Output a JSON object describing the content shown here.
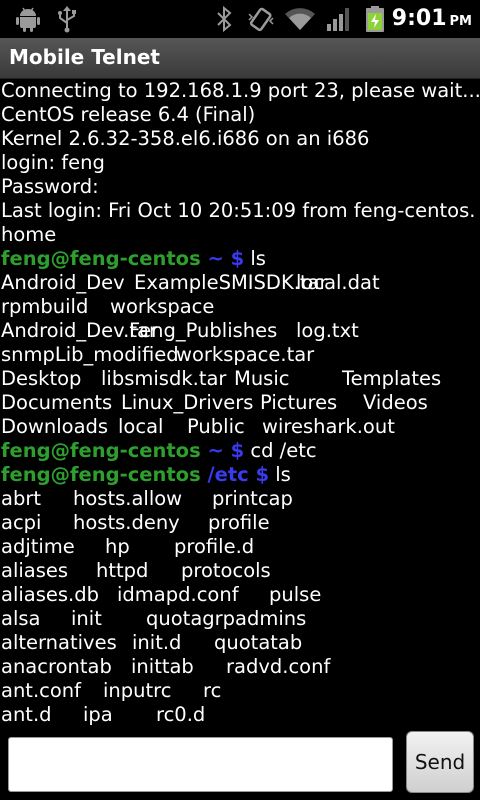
{
  "status_bar": {
    "icons": [
      "android-debug-icon",
      "usb-icon",
      "bluetooth-icon",
      "vibrate-icon",
      "wifi-icon",
      "signal-icon",
      "battery-charging-icon"
    ],
    "time": "9:01",
    "ampm": "PM"
  },
  "app": {
    "title": "Mobile Telnet"
  },
  "colors": {
    "user": "#2e9f2e",
    "path": "#3a3aee",
    "title_bar": "#4a4a4a"
  },
  "terminal": {
    "lines": [
      {
        "segments": [
          {
            "text": "Connecting to 192.168.1.9 port 23, please wait..."
          }
        ]
      },
      {
        "segments": [
          {
            "text": "CentOS release 6.4 (Final)"
          }
        ]
      },
      {
        "segments": [
          {
            "text": "Kernel 2.6.32-358.el6.i686 on an i686"
          }
        ]
      },
      {
        "segments": [
          {
            "text": "login: feng"
          }
        ]
      },
      {
        "segments": [
          {
            "text": "Password:"
          }
        ]
      },
      {
        "segments": [
          {
            "text": "Last login: Fri Oct 10 20:51:09 from feng-centos."
          }
        ]
      },
      {
        "segments": [
          {
            "text": "home"
          }
        ]
      },
      {
        "segments": [
          {
            "text": "feng@feng-centos",
            "cls": "user"
          },
          {
            "text": " ~ $",
            "cls": "path"
          },
          {
            "text": " ls"
          }
        ]
      },
      {
        "cols": [
          0,
          133,
          295
        ],
        "cells": [
          "Android_Dev",
          "ExampleSMISDK.tar",
          "local.dat"
        ]
      },
      {
        "cols": [
          0,
          109
        ],
        "cells": [
          "rpmbuild",
          "workspace"
        ]
      },
      {
        "cols": [
          0,
          128,
          295
        ],
        "cells": [
          "Android_Dev.tar",
          "Feng_Publishes",
          "log.txt"
        ]
      },
      {
        "cols": [
          0,
          175
        ],
        "cells": [
          "snmpLib_modified",
          "workspace.tar"
        ]
      },
      {
        "cols": [
          0,
          100,
          233,
          341
        ],
        "cells": [
          "Desktop",
          "libsmisdk.tar",
          "Music",
          "Templates"
        ]
      },
      {
        "cols": [
          0,
          120,
          259,
          362
        ],
        "cells": [
          "Documents",
          "Linux_Drivers",
          "Pictures",
          "Videos"
        ]
      },
      {
        "cols": [
          0,
          117,
          186,
          261
        ],
        "cells": [
          "Downloads",
          "local",
          "Public",
          "wireshark.out"
        ]
      },
      {
        "segments": [
          {
            "text": "feng@feng-centos",
            "cls": "user"
          },
          {
            "text": " ~ $",
            "cls": "path"
          },
          {
            "text": " cd /etc"
          }
        ]
      },
      {
        "segments": [
          {
            "text": "feng@feng-centos",
            "cls": "user"
          },
          {
            "text": " /etc $",
            "cls": "path"
          },
          {
            "text": " ls"
          }
        ]
      },
      {
        "cols": [
          0,
          72,
          211
        ],
        "cells": [
          "abrt",
          "hosts.allow",
          "printcap"
        ]
      },
      {
        "cols": [
          0,
          72,
          207
        ],
        "cells": [
          "acpi",
          "hosts.deny",
          "profile"
        ]
      },
      {
        "cols": [
          0,
          104,
          173
        ],
        "cells": [
          "adjtime",
          "hp",
          "profile.d"
        ]
      },
      {
        "cols": [
          0,
          95,
          180
        ],
        "cells": [
          "aliases",
          "httpd",
          "protocols"
        ]
      },
      {
        "cols": [
          0,
          116,
          268
        ],
        "cells": [
          "aliases.db",
          "idmapd.conf",
          "pulse"
        ]
      },
      {
        "cols": [
          0,
          70,
          145
        ],
        "cells": [
          "alsa",
          "init",
          "quotagrpadmins"
        ]
      },
      {
        "cols": [
          0,
          131,
          213
        ],
        "cells": [
          "alternatives",
          "init.d",
          "quotatab"
        ]
      },
      {
        "cols": [
          0,
          130,
          225
        ],
        "cells": [
          "anacrontab",
          "inittab",
          "radvd.conf"
        ]
      },
      {
        "cols": [
          0,
          102,
          202
        ],
        "cells": [
          "ant.conf",
          "inputrc",
          "rc"
        ]
      },
      {
        "cols": [
          0,
          82,
          155
        ],
        "cells": [
          "ant.d",
          "ipa",
          "rc0.d"
        ]
      }
    ]
  },
  "input": {
    "value": "",
    "placeholder": ""
  },
  "send_button": {
    "label": "Send"
  }
}
